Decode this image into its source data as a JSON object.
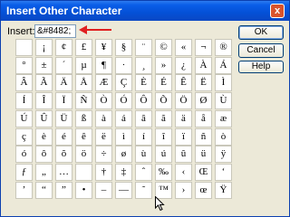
{
  "window": {
    "title": "Insert Other Character",
    "close_label": "x"
  },
  "insert": {
    "label": "Insert:",
    "value": "&#8482;"
  },
  "buttons": {
    "ok": "OK",
    "cancel": "Cancel",
    "help": "Help"
  },
  "characters": [
    [
      "",
      "¡",
      "¢",
      "£",
      "¥",
      "§",
      "¨",
      "©",
      "«",
      "¬",
      "®"
    ],
    [
      "°",
      "±",
      "´",
      "µ",
      "¶",
      "·",
      "¸",
      "»",
      "¿",
      "À",
      "Á"
    ],
    [
      "Â",
      "Ã",
      "Ä",
      "Å",
      "Æ",
      "Ç",
      "È",
      "É",
      "Ê",
      "Ë",
      "Ì"
    ],
    [
      "Í",
      "Î",
      "Ï",
      "Ñ",
      "Ò",
      "Ó",
      "Ô",
      "Õ",
      "Ö",
      "Ø",
      "Ù"
    ],
    [
      "Ú",
      "Û",
      "Ü",
      "ß",
      "à",
      "á",
      "â",
      "ã",
      "ä",
      "å",
      "æ"
    ],
    [
      "ç",
      "è",
      "é",
      "ê",
      "ë",
      "ì",
      "í",
      "î",
      "ï",
      "ñ",
      "ò"
    ],
    [
      "ó",
      "ô",
      "õ",
      "ö",
      "÷",
      "ø",
      "ù",
      "ú",
      "û",
      "ü",
      "ÿ"
    ],
    [
      "ƒ",
      "„",
      "…",
      "",
      "†",
      "‡",
      "ˆ",
      "‰",
      "‹",
      "Œ",
      "‘"
    ],
    [
      "’",
      "“",
      "”",
      "•",
      "–",
      "—",
      "˜",
      "™",
      "›",
      "œ",
      "Ÿ"
    ]
  ]
}
